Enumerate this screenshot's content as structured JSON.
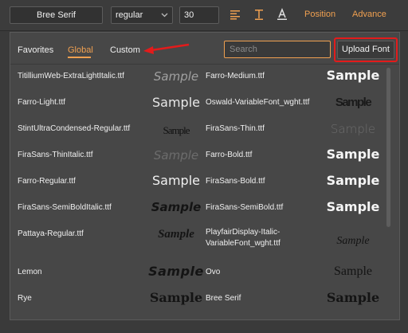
{
  "toolbar": {
    "font_name": "Bree Serif",
    "font_style": "regular",
    "font_size": "30",
    "position_label": "Position",
    "advance_label": "Advance"
  },
  "tabs": [
    {
      "label": "Favorites",
      "active": false
    },
    {
      "label": "Global",
      "active": true
    },
    {
      "label": "Custom",
      "active": false
    }
  ],
  "search": {
    "placeholder": "Search"
  },
  "upload_label": "Upload Font",
  "sample_text": "Sample",
  "fonts": [
    {
      "left": "TitilliumWeb-ExtraLightItalic.ttf",
      "right": "Farro-Medium.ttf"
    },
    {
      "left": "Farro-Light.ttf",
      "right": "Oswald-VariableFont_wght.ttf"
    },
    {
      "left": "StintUltraCondensed-Regular.ttf",
      "right": "FiraSans-Thin.ttf"
    },
    {
      "left": "FiraSans-ThinItalic.ttf",
      "right": "Farro-Bold.ttf"
    },
    {
      "left": "Farro-Regular.ttf",
      "right": "FiraSans-Bold.ttf"
    },
    {
      "left": "FiraSans-SemiBoldItalic.ttf",
      "right": "FiraSans-SemiBold.ttf"
    },
    {
      "left": "Pattaya-Regular.ttf",
      "right": "PlayfairDisplay-Italic-VariableFont_wght.ttf"
    },
    {
      "left": "Lemon",
      "right": "Ovo"
    },
    {
      "left": "Rye",
      "right": "Bree Serif"
    }
  ],
  "colors": {
    "accent": "#f0a050",
    "highlight": "#e31b1b",
    "panel": "#474747"
  }
}
